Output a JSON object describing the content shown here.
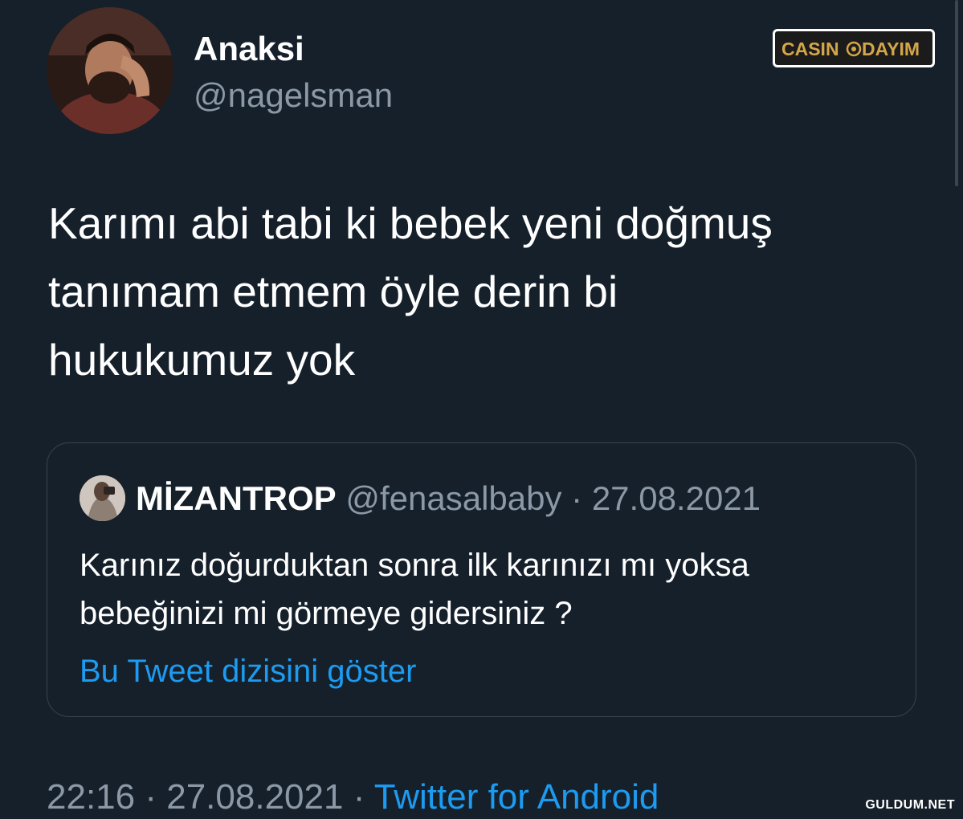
{
  "author": {
    "display_name": "Anaksi",
    "handle": "@nagelsman",
    "avatar_icon": "profile-photo"
  },
  "watermark": {
    "brand_text": "CASIN",
    "brand_text_2": "DAYIM",
    "site_text": "GULDUM.NET"
  },
  "tweet": {
    "text_lines": [
      "Karımı abi tabi ki bebek yeni doğmuş",
      "tanımam etmem öyle derin bi",
      "hukukumuz yok"
    ]
  },
  "quoted_tweet": {
    "display_name": "MİZANTROP",
    "handle": "@fenasalbaby",
    "separator": "·",
    "date": "27.08.2021",
    "text_lines": [
      "Karınız doğurduktan sonra ilk karınızı mı yoksa",
      "bebeğinizi mi görmeye gidersiniz ?"
    ],
    "thread_link": "Bu Tweet dizisini göster"
  },
  "meta": {
    "time": "22:16",
    "separator": "·",
    "date": "27.08.2021",
    "source": "Twitter for Android"
  },
  "colors": {
    "background": "#15202b",
    "text_primary": "#ffffff",
    "text_secondary": "#8b98a5",
    "link": "#1d9bf0",
    "border": "#38444d",
    "brand_gold": "#d4a64a"
  }
}
